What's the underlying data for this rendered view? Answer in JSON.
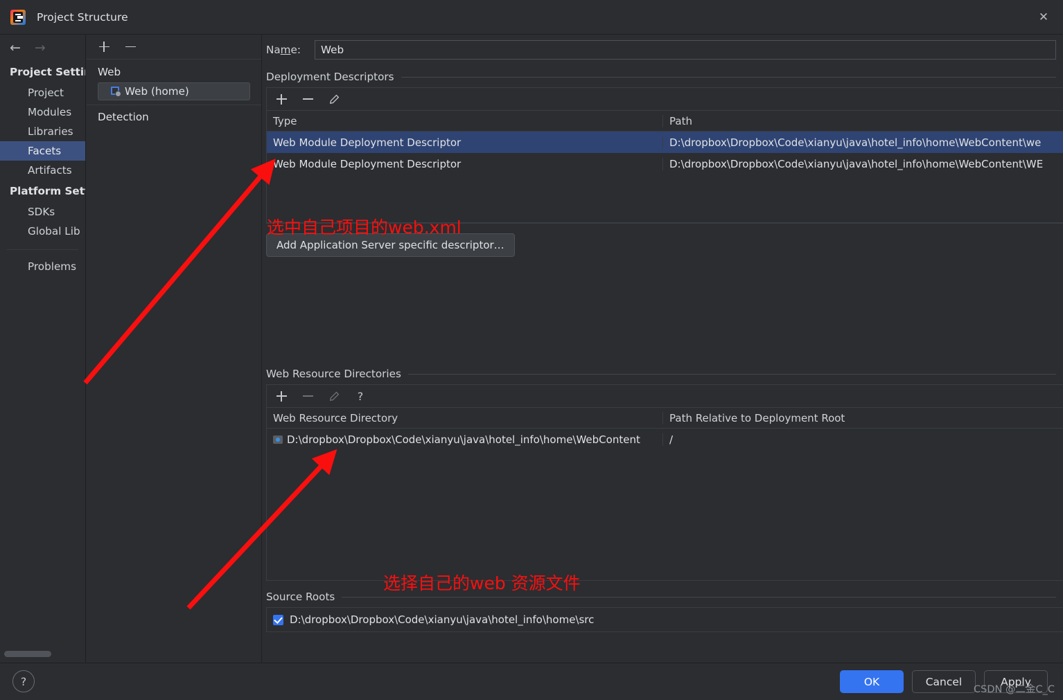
{
  "window": {
    "title": "Project Structure",
    "app_icon": "intellij-idea-logo",
    "close_icon": "close-icon"
  },
  "nav": {
    "back_icon": "arrow-left-icon",
    "forward_icon": "arrow-right-icon"
  },
  "sidebar": {
    "groups": [
      {
        "title": "Project Settir",
        "items": [
          {
            "label": "Project",
            "selected": false
          },
          {
            "label": "Modules",
            "selected": false
          },
          {
            "label": "Libraries",
            "selected": false
          },
          {
            "label": "Facets",
            "selected": true
          },
          {
            "label": "Artifacts",
            "selected": false
          }
        ]
      },
      {
        "title": "Platform Sett",
        "items": [
          {
            "label": "SDKs",
            "selected": false
          },
          {
            "label": "Global Lib",
            "selected": false
          }
        ]
      }
    ],
    "extra": [
      {
        "label": "Problems",
        "selected": false
      }
    ]
  },
  "facet_tree": {
    "toolbar": [
      {
        "icon": "plus-icon",
        "enabled": true
      },
      {
        "icon": "minus-icon",
        "enabled": true
      }
    ],
    "root_label": "Web",
    "child_label": "Web (home)",
    "child_icon": "web-facet-icon",
    "detection_label": "Detection"
  },
  "main": {
    "name_label_pre": "Na",
    "name_label_mnemonic": "m",
    "name_label_post": "e:",
    "name_value": "Web",
    "deployment_descriptors": {
      "title": "Deployment Descriptors",
      "toolbar": [
        {
          "icon": "plus-icon",
          "enabled": true
        },
        {
          "icon": "minus-icon",
          "enabled": true
        },
        {
          "icon": "pencil-icon",
          "enabled": true
        }
      ],
      "columns": [
        "Type",
        "Path"
      ],
      "rows": [
        {
          "type": "Web Module Deployment Descriptor",
          "path": "D:\\dropbox\\Dropbox\\Code\\xianyu\\java\\hotel_info\\home\\WebContent\\we",
          "selected": true
        },
        {
          "type": "Web Module Deployment Descriptor",
          "path": "D:\\dropbox\\Dropbox\\Code\\xianyu\\java\\hotel_info\\home\\WebContent\\WE",
          "selected": false
        }
      ],
      "add_descriptor_button": "Add Application Server specific descriptor…"
    },
    "web_resource_directories": {
      "title": "Web Resource Directories",
      "toolbar": [
        {
          "icon": "plus-icon",
          "enabled": true
        },
        {
          "icon": "minus-icon",
          "enabled": false
        },
        {
          "icon": "pencil-icon",
          "enabled": false
        },
        {
          "icon": "help-icon",
          "enabled": true
        }
      ],
      "columns": [
        "Web Resource Directory",
        "Path Relative to Deployment Root"
      ],
      "rows": [
        {
          "directory": "D:\\dropbox\\Dropbox\\Code\\xianyu\\java\\hotel_info\\home\\WebContent",
          "relative_path": "/",
          "icon": "folder-icon"
        }
      ]
    },
    "source_roots": {
      "title": "Source Roots",
      "rows": [
        {
          "path": "D:\\dropbox\\Dropbox\\Code\\xianyu\\java\\hotel_info\\home\\src",
          "checked": true
        }
      ]
    }
  },
  "annotations": {
    "color": "#fa0f0f",
    "notes": [
      {
        "text": "选中自己项目的web.xml"
      },
      {
        "text": "选择自己的web 资源文件"
      }
    ]
  },
  "footer": {
    "help_icon": "help-icon",
    "buttons": [
      {
        "label": "OK",
        "style": "primary"
      },
      {
        "label": "Cancel",
        "style": "normal"
      },
      {
        "label": "Apply",
        "style": "normal"
      }
    ]
  },
  "watermark": "CSDN @二金C_C"
}
